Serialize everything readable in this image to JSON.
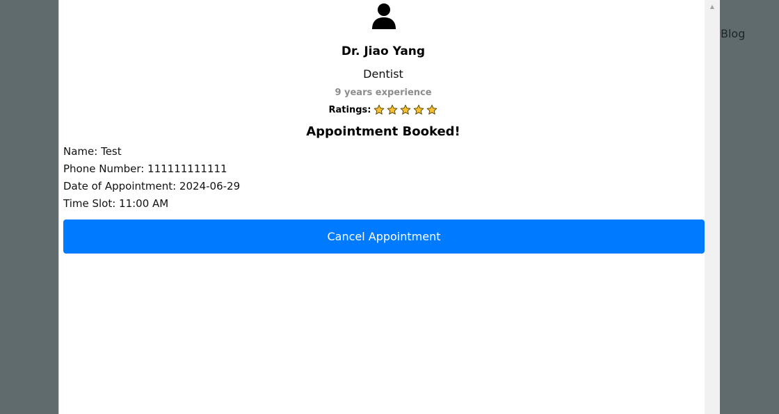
{
  "background": {
    "nav_link_blog": "Blog"
  },
  "modal": {
    "icon": "user-profile-icon",
    "doctor": {
      "name": "Dr. Jiao Yang",
      "specialty": "Dentist",
      "experience": "9 years experience",
      "ratings_label": "Ratings:",
      "rating_stars": 5,
      "star_icon": "star-icon"
    },
    "booked_title": "Appointment Booked!",
    "details": {
      "name": "Name: Test",
      "phone": "Phone Number: 111111111111",
      "date": "Date of Appointment: 2024-06-29",
      "time_slot": "Time Slot: 11:00 AM"
    },
    "cancel_button_label": "Cancel Appointment"
  },
  "colors": {
    "accent": "#007bff",
    "overlay": "#5f6b6d",
    "star_fill": "#f6c232"
  }
}
